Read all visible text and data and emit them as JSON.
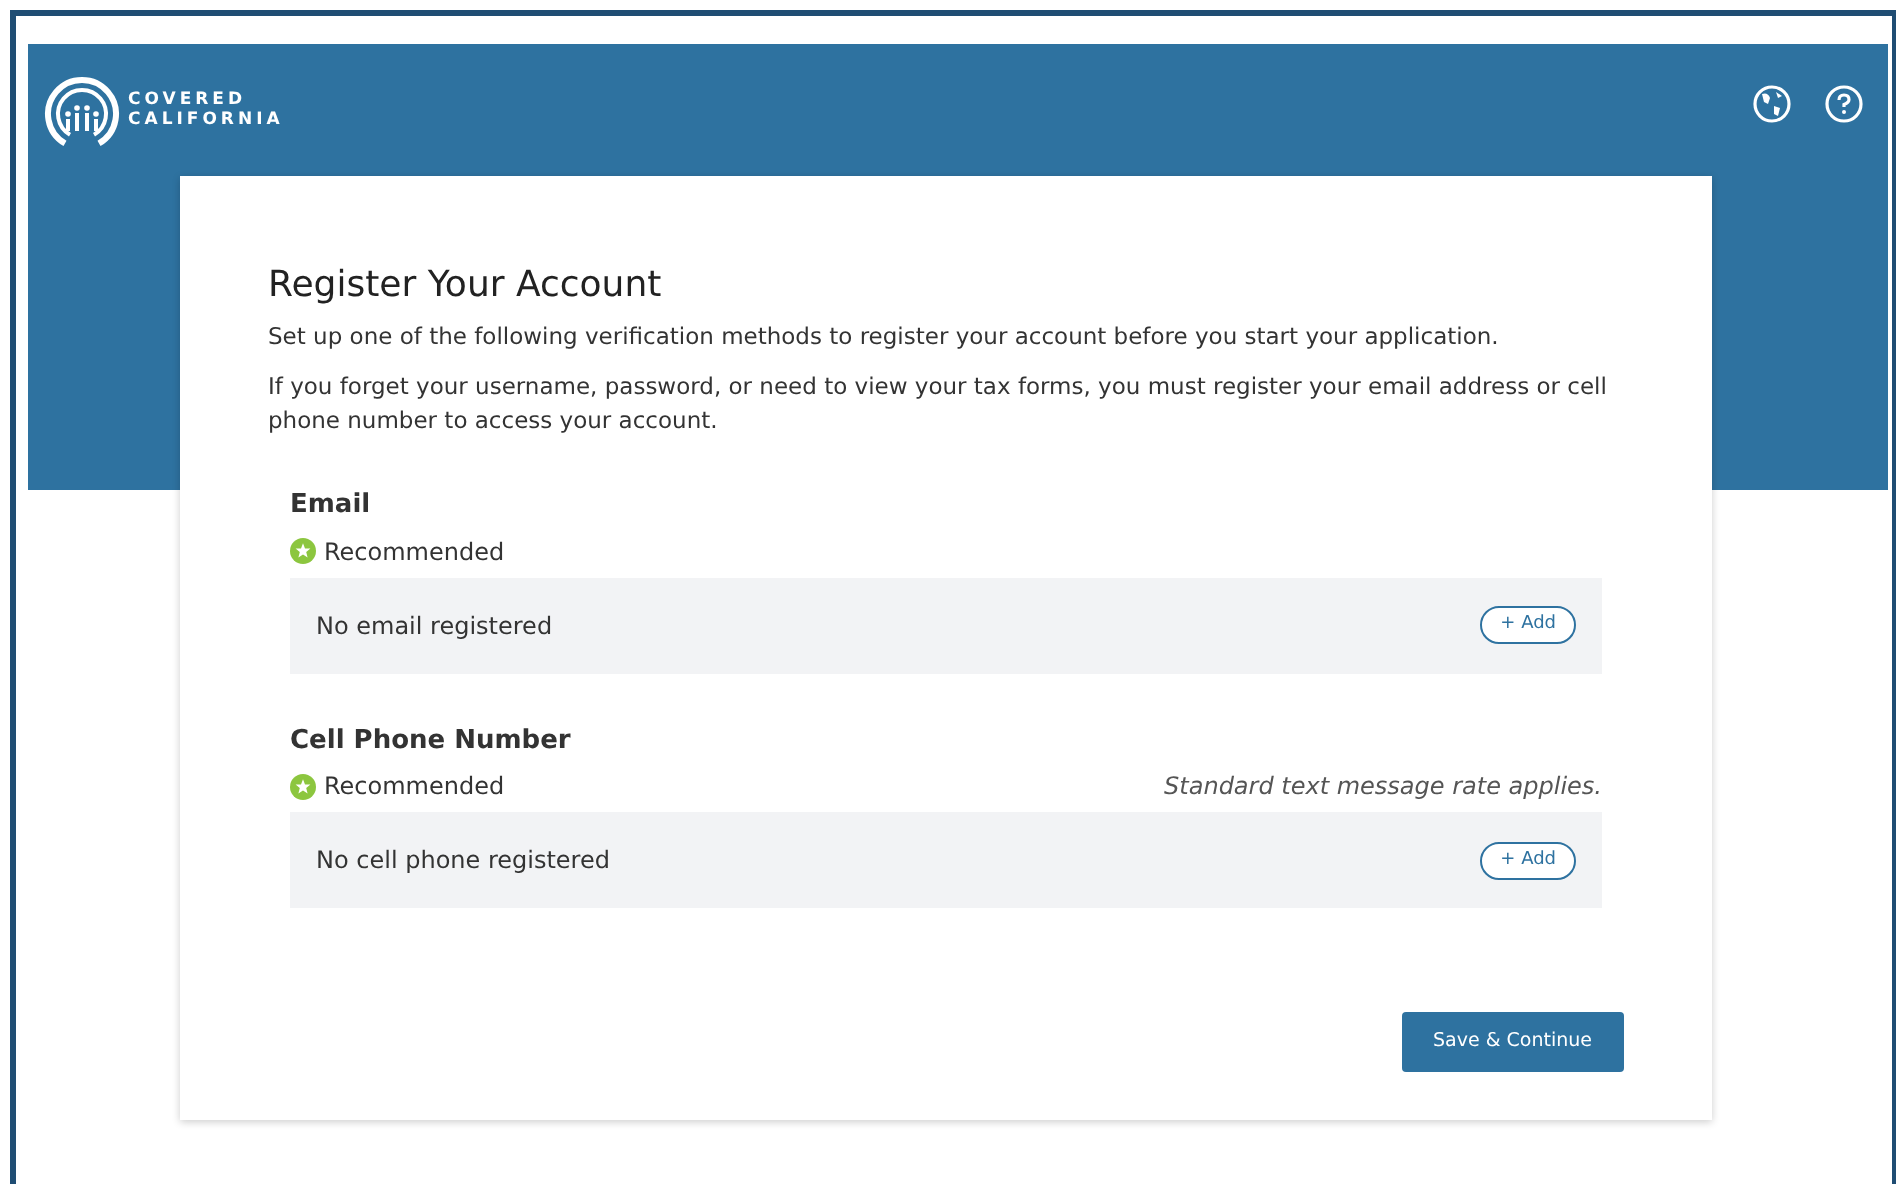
{
  "header": {
    "logo_line_1": "COVERED",
    "logo_line_2": "CALIFORNIA"
  },
  "card": {
    "title": "Register Your Account",
    "paragraphs": [
      "Set up one of the following verification methods to register your account before you start your application.",
      "If you forget your username, password, or need to view your tax forms, you must register your email address or cell phone number to access your account."
    ],
    "methods": [
      {
        "label": "Email",
        "recommended": true,
        "badge": "Recommended",
        "status": "No email registered",
        "button": "+ Add"
      },
      {
        "label": "Cell Phone Number",
        "recommended": true,
        "badge": "Recommended",
        "note": "Standard text message rate applies.",
        "status": "No cell phone registered",
        "button": "+ Add"
      }
    ],
    "primary_button": "Save & Continue"
  }
}
